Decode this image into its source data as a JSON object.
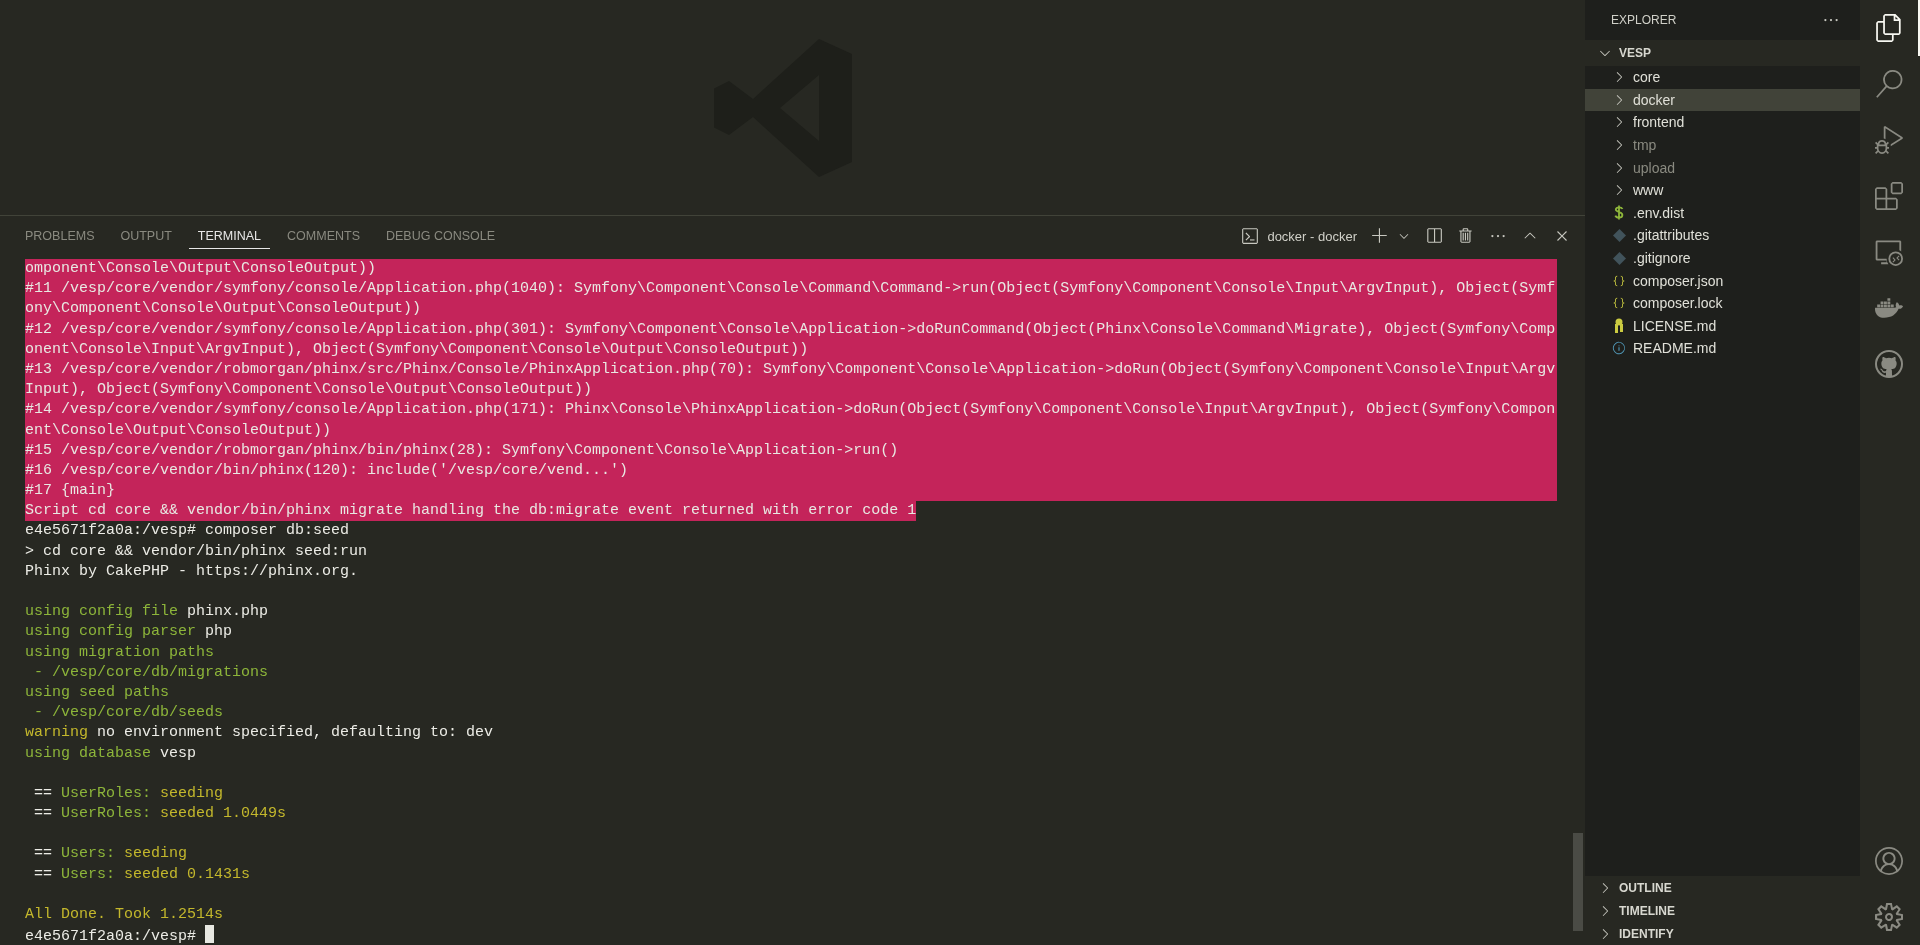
{
  "panel": {
    "tabs": [
      {
        "label": "PROBLEMS",
        "selected": false
      },
      {
        "label": "OUTPUT",
        "selected": false
      },
      {
        "label": "TERMINAL",
        "selected": true
      },
      {
        "label": "COMMENTS",
        "selected": false
      },
      {
        "label": "DEBUG CONSOLE",
        "selected": false
      }
    ],
    "terminal_name": "docker - docker"
  },
  "terminal": {
    "lines": [
      {
        "kind": "error",
        "text": "omponent\\Console\\Output\\ConsoleOutput))"
      },
      {
        "kind": "error",
        "text": "#11 /vesp/core/vendor/symfony/console/Application.php(1040): Symfony\\Component\\Console\\Command\\Command->run(Object(Symfony\\Component\\Console\\Input\\ArgvInput), Object(Symf"
      },
      {
        "kind": "error",
        "text": "ony\\Component\\Console\\Output\\ConsoleOutput))"
      },
      {
        "kind": "error",
        "text": "#12 /vesp/core/vendor/symfony/console/Application.php(301): Symfony\\Component\\Console\\Application->doRunCommand(Object(Phinx\\Console\\Command\\Migrate), Object(Symfony\\Comp"
      },
      {
        "kind": "error",
        "text": "onent\\Console\\Input\\ArgvInput), Object(Symfony\\Component\\Console\\Output\\ConsoleOutput))"
      },
      {
        "kind": "error",
        "text": "#13 /vesp/core/vendor/robmorgan/phinx/src/Phinx/Console/PhinxApplication.php(70): Symfony\\Component\\Console\\Application->doRun(Object(Symfony\\Component\\Console\\Input\\Argv"
      },
      {
        "kind": "error",
        "text": "Input), Object(Symfony\\Component\\Console\\Output\\ConsoleOutput))"
      },
      {
        "kind": "error",
        "text": "#14 /vesp/core/vendor/symfony/console/Application.php(171): Phinx\\Console\\PhinxApplication->doRun(Object(Symfony\\Component\\Console\\Input\\ArgvInput), Object(Symfony\\Compon"
      },
      {
        "kind": "error",
        "text": "ent\\Console\\Output\\ConsoleOutput))"
      },
      {
        "kind": "error",
        "text": "#15 /vesp/core/vendor/robmorgan/phinx/bin/phinx(28): Symfony\\Component\\Console\\Application->run()"
      },
      {
        "kind": "error",
        "text": "#16 /vesp/core/vendor/bin/phinx(120): include('/vesp/core/vend...')"
      },
      {
        "kind": "error",
        "text": "#17 {main}"
      },
      {
        "kind": "error-end",
        "text": "Script cd core && vendor/bin/phinx migrate handling the db:migrate event returned with error code 1"
      },
      {
        "kind": "text",
        "segments": [
          {
            "text": "e4e5671f2a0a:/vesp# composer db:seed",
            "color": "#ecece6"
          }
        ]
      },
      {
        "kind": "text",
        "segments": [
          {
            "text": "> cd core && vendor/bin/phinx seed:run",
            "color": "#ecece6"
          }
        ]
      },
      {
        "kind": "text",
        "segments": [
          {
            "text": "Phinx by CakePHP - https://phinx.org.",
            "color": "#ecece6"
          }
        ]
      },
      {
        "kind": "blank"
      },
      {
        "kind": "text",
        "segments": [
          {
            "text": "using config file ",
            "color": "#8db53a"
          },
          {
            "text": "phinx.php",
            "color": "#ecece6"
          }
        ]
      },
      {
        "kind": "text",
        "segments": [
          {
            "text": "using config parser ",
            "color": "#8db53a"
          },
          {
            "text": "php",
            "color": "#ecece6"
          }
        ]
      },
      {
        "kind": "text",
        "segments": [
          {
            "text": "using migration paths",
            "color": "#8db53a"
          }
        ]
      },
      {
        "kind": "text",
        "segments": [
          {
            "text": " - /vesp/core/db/migrations",
            "color": "#8db53a"
          }
        ]
      },
      {
        "kind": "text",
        "segments": [
          {
            "text": "using seed paths",
            "color": "#8db53a"
          }
        ]
      },
      {
        "kind": "text",
        "segments": [
          {
            "text": " - /vesp/core/db/seeds",
            "color": "#8db53a"
          }
        ]
      },
      {
        "kind": "text",
        "segments": [
          {
            "text": "warning ",
            "color": "#c4b82c"
          },
          {
            "text": "no environment specified, defaulting to: dev",
            "color": "#ecece6"
          }
        ]
      },
      {
        "kind": "text",
        "segments": [
          {
            "text": "using database ",
            "color": "#8db53a"
          },
          {
            "text": "vesp",
            "color": "#ecece6"
          }
        ]
      },
      {
        "kind": "blank"
      },
      {
        "kind": "text",
        "segments": [
          {
            "text": " == ",
            "color": "#ecece6"
          },
          {
            "text": "UserRoles:",
            "color": "#8db53a"
          },
          {
            "text": " seeding",
            "color": "#c4b82c"
          }
        ]
      },
      {
        "kind": "text",
        "segments": [
          {
            "text": " == ",
            "color": "#ecece6"
          },
          {
            "text": "UserRoles:",
            "color": "#8db53a"
          },
          {
            "text": " seeded 1.0449s",
            "color": "#c4b82c"
          }
        ]
      },
      {
        "kind": "blank"
      },
      {
        "kind": "text",
        "segments": [
          {
            "text": " == ",
            "color": "#ecece6"
          },
          {
            "text": "Users:",
            "color": "#8db53a"
          },
          {
            "text": " seeding",
            "color": "#c4b82c"
          }
        ]
      },
      {
        "kind": "text",
        "segments": [
          {
            "text": " == ",
            "color": "#ecece6"
          },
          {
            "text": "Users:",
            "color": "#8db53a"
          },
          {
            "text": " seeded 0.1431s",
            "color": "#c4b82c"
          }
        ]
      },
      {
        "kind": "blank"
      },
      {
        "kind": "text",
        "segments": [
          {
            "text": "All Done. Took 1.2514s",
            "color": "#c4b82c"
          }
        ]
      },
      {
        "kind": "prompt",
        "segments": [
          {
            "text": "e4e5671f2a0a:/vesp# ",
            "color": "#ecece6"
          }
        ]
      }
    ]
  },
  "explorer": {
    "title": "EXPLORER",
    "root": {
      "label": "VESP",
      "expanded": true
    },
    "items": [
      {
        "label": "core",
        "kind": "folder",
        "selected": false,
        "dimmed": false
      },
      {
        "label": "docker",
        "kind": "folder",
        "selected": true,
        "dimmed": false
      },
      {
        "label": "frontend",
        "kind": "folder",
        "selected": false,
        "dimmed": false
      },
      {
        "label": "tmp",
        "kind": "folder",
        "selected": false,
        "dimmed": true
      },
      {
        "label": "upload",
        "kind": "folder",
        "selected": false,
        "dimmed": true
      },
      {
        "label": "www",
        "kind": "folder",
        "selected": false,
        "dimmed": false
      },
      {
        "label": ".env.dist",
        "kind": "env",
        "selected": false,
        "dimmed": false
      },
      {
        "label": ".gitattributes",
        "kind": "git",
        "selected": false,
        "dimmed": false
      },
      {
        "label": ".gitignore",
        "kind": "git",
        "selected": false,
        "dimmed": false
      },
      {
        "label": "composer.json",
        "kind": "json",
        "selected": false,
        "dimmed": false
      },
      {
        "label": "composer.lock",
        "kind": "json",
        "selected": false,
        "dimmed": false
      },
      {
        "label": "LICENSE.md",
        "kind": "license",
        "selected": false,
        "dimmed": false
      },
      {
        "label": "README.md",
        "kind": "info",
        "selected": false,
        "dimmed": false
      }
    ],
    "sections": [
      {
        "label": "OUTLINE",
        "expanded": false
      },
      {
        "label": "TIMELINE",
        "expanded": false
      },
      {
        "label": "IDENTIFY",
        "expanded": false
      }
    ]
  },
  "activity_bar": {
    "items": [
      {
        "kind": "files",
        "selected": true
      },
      {
        "kind": "search",
        "selected": false
      },
      {
        "kind": "debug",
        "selected": false
      },
      {
        "kind": "extensions",
        "selected": false
      },
      {
        "kind": "remote",
        "selected": false
      },
      {
        "kind": "docker",
        "selected": false
      },
      {
        "kind": "github",
        "selected": false
      }
    ],
    "bottom": [
      {
        "kind": "account"
      },
      {
        "kind": "settings"
      }
    ]
  }
}
